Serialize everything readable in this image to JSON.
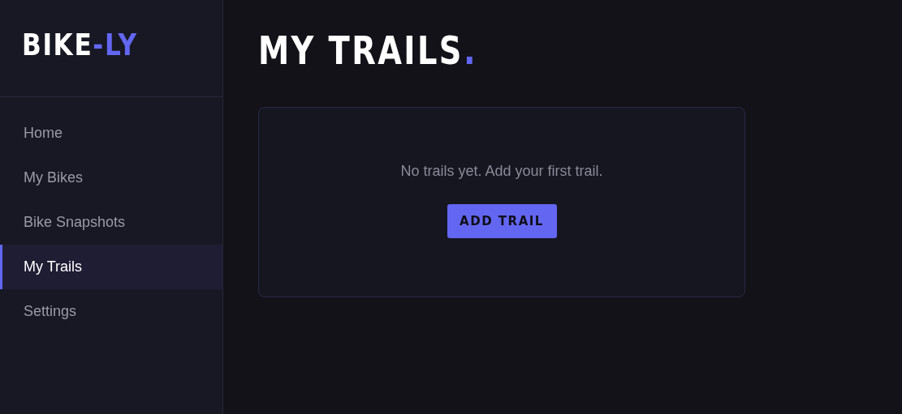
{
  "logo": {
    "main": "BIKE",
    "accent": "-LY"
  },
  "nav": [
    {
      "label": "Home",
      "selected": false
    },
    {
      "label": "My Bikes",
      "selected": false
    },
    {
      "label": "Bike Snapshots",
      "selected": false
    },
    {
      "label": "My Trails",
      "selected": true
    },
    {
      "label": "Settings",
      "selected": false
    }
  ],
  "page": {
    "title": "MY TRAILS",
    "title_accent": "."
  },
  "empty_state": {
    "message": "No trails yet. Add your first trail.",
    "button": "ADD TRAIL"
  }
}
